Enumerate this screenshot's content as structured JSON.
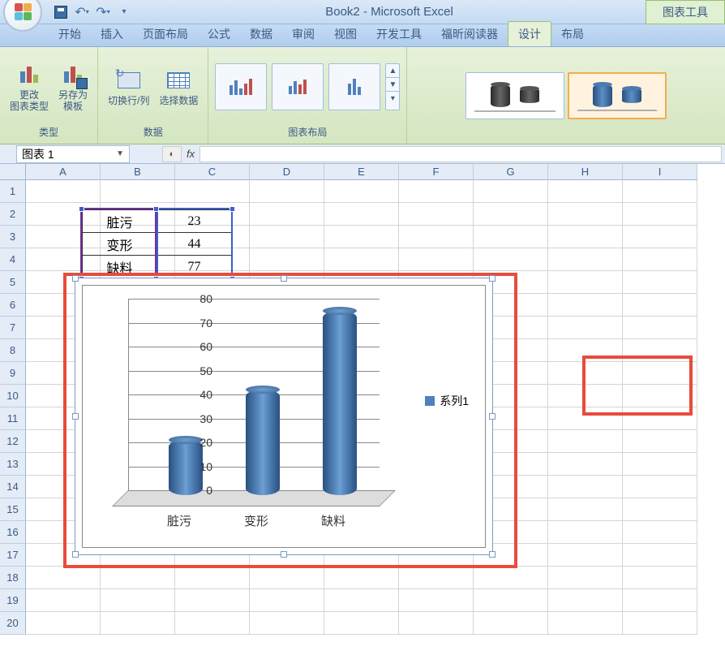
{
  "title": "Book2 - Microsoft Excel",
  "chart_tools_label": "图表工具",
  "tabs": {
    "home": "开始",
    "insert": "插入",
    "page_layout": "页面布局",
    "formulas": "公式",
    "data": "数据",
    "review": "审阅",
    "view": "视图",
    "developer": "开发工具",
    "foxit": "福昕阅读器",
    "design": "设计",
    "layout": "布局"
  },
  "ribbon": {
    "change_type": "更改\n图表类型",
    "save_template": "另存为\n模板",
    "group_type": "类型",
    "swap": "切换行/列",
    "select_data": "选择数据",
    "group_data": "数据",
    "group_layout": "图表布局"
  },
  "name_box": "图表 1",
  "fx": "fx",
  "columns": [
    "A",
    "B",
    "C",
    "D",
    "E",
    "F",
    "G",
    "H",
    "I"
  ],
  "rows": [
    "1",
    "2",
    "3",
    "4",
    "5",
    "6",
    "7",
    "8",
    "9",
    "10",
    "11",
    "12",
    "13",
    "14",
    "15",
    "16",
    "17",
    "18",
    "19",
    "20"
  ],
  "table": {
    "r1c1": "脏污",
    "r1c2": "23",
    "r2c1": "变形",
    "r2c2": "44",
    "r3c1": "缺料",
    "r3c2": "77"
  },
  "legend_label": "系列1",
  "y_ticks": {
    "t0": "0",
    "t10": "10",
    "t20": "20",
    "t30": "30",
    "t40": "40",
    "t50": "50",
    "t60": "60",
    "t70": "70",
    "t80": "80"
  },
  "x_ticks": {
    "c1": "脏污",
    "c2": "变形",
    "c3": "缺料"
  },
  "chart_data": {
    "type": "bar",
    "categories": [
      "脏污",
      "变形",
      "缺料"
    ],
    "values": [
      23,
      44,
      77
    ],
    "series_name": "系列1",
    "ylim": [
      0,
      80
    ],
    "xlabel": "",
    "ylabel": "",
    "title": ""
  }
}
